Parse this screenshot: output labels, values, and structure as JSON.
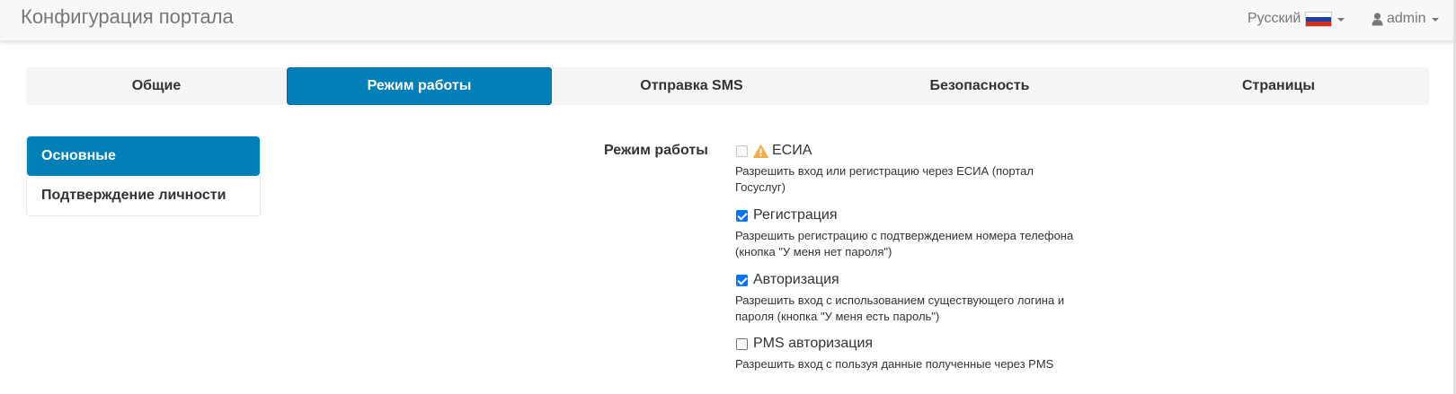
{
  "header": {
    "title": "Конфигурация портала",
    "language": "Русский",
    "flag_icon": "russia-flag-icon",
    "user": "admin",
    "user_icon": "user-icon"
  },
  "tabs": [
    {
      "label": "Общие",
      "active": false
    },
    {
      "label": "Режим работы",
      "active": true
    },
    {
      "label": "Отправка SMS",
      "active": false
    },
    {
      "label": "Безопасность",
      "active": false
    },
    {
      "label": "Страницы",
      "active": false
    }
  ],
  "sidebar": {
    "items": [
      {
        "label": "Основные",
        "active": true
      },
      {
        "label": "Подтверждение личности",
        "active": false
      }
    ]
  },
  "form": {
    "label": "Режим работы",
    "options": [
      {
        "title": "ЕСИА",
        "checked": false,
        "disabled": true,
        "warning_icon": "warning-icon",
        "description": "Разрешить вход или регистрацию через ЕСИА (портал Госуслуг)"
      },
      {
        "title": "Регистрация",
        "checked": true,
        "disabled": false,
        "description": "Разрешить регистрацию с подтверждением номера телефона (кнопка \"У меня нет пароля\")"
      },
      {
        "title": "Авторизация",
        "checked": true,
        "disabled": false,
        "description": "Разрешить вход с использованием существующего логина и пароля (кнопка \"У меня есть пароль\")"
      },
      {
        "title": "PMS авторизация",
        "checked": false,
        "disabled": false,
        "description": "Разрешить вход с пользуя данные полученные через PMS"
      }
    ]
  },
  "colors": {
    "accent": "#0080b7",
    "checkbox_checked": "#0075ff",
    "warning": "#f0ad4e"
  }
}
